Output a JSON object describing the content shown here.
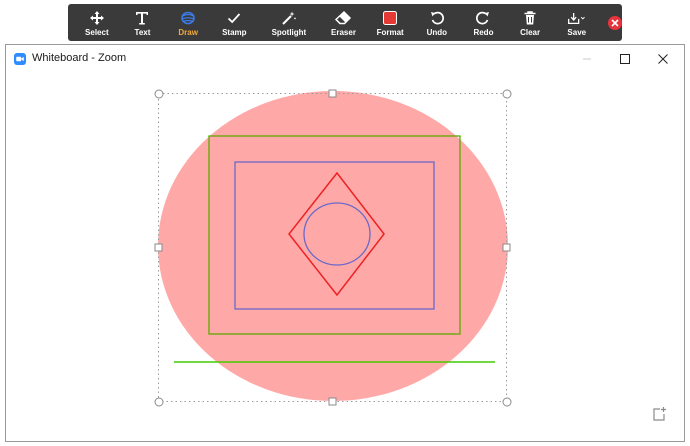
{
  "toolbar": {
    "tools": [
      {
        "id": "select",
        "label": "Select",
        "icon": "move-arrows-icon"
      },
      {
        "id": "text",
        "label": "Text",
        "icon": "text-t-icon"
      },
      {
        "id": "draw",
        "label": "Draw",
        "icon": "draw-scribble-icon",
        "active": true
      },
      {
        "id": "stamp",
        "label": "Stamp",
        "icon": "checkmark-icon"
      },
      {
        "id": "spotlight",
        "label": "Spotlight",
        "icon": "magic-wand-icon"
      },
      {
        "id": "eraser",
        "label": "Eraser",
        "icon": "eraser-icon"
      },
      {
        "id": "format",
        "label": "Format",
        "icon": "color-swatch-icon"
      },
      {
        "id": "undo",
        "label": "Undo",
        "icon": "undo-icon"
      },
      {
        "id": "redo",
        "label": "Redo",
        "icon": "redo-icon"
      },
      {
        "id": "clear",
        "label": "Clear",
        "icon": "trash-icon"
      },
      {
        "id": "save",
        "label": "Save",
        "icon": "save-download-icon"
      }
    ],
    "colors": {
      "background": "#3a3a3a",
      "active_label": "#f2a93b",
      "format_swatch": "#e53935",
      "close": "#e8333d"
    }
  },
  "window": {
    "title": "Whiteboard - Zoom",
    "icon": "zoom-camera-icon",
    "controls": [
      "minimize",
      "maximize",
      "close"
    ]
  },
  "whiteboard": {
    "shapes": [
      {
        "type": "ellipse",
        "fill": "#ffa8a8",
        "role": "large filled ellipse"
      },
      {
        "type": "rectangle",
        "stroke": "#5fa800",
        "role": "outer green rectangle"
      },
      {
        "type": "rectangle",
        "stroke": "#6a68c8",
        "role": "inner blue rectangle"
      },
      {
        "type": "diamond",
        "stroke": "#ee2222",
        "role": "red diamond"
      },
      {
        "type": "ellipse",
        "stroke": "#6a68c8",
        "role": "small blue ellipse"
      },
      {
        "type": "line",
        "stroke": "#44cc00",
        "role": "green horizontal line"
      }
    ],
    "selection": {
      "style": "dotted",
      "handles": 8
    }
  },
  "corner_icon": "new-whiteboard-icon"
}
